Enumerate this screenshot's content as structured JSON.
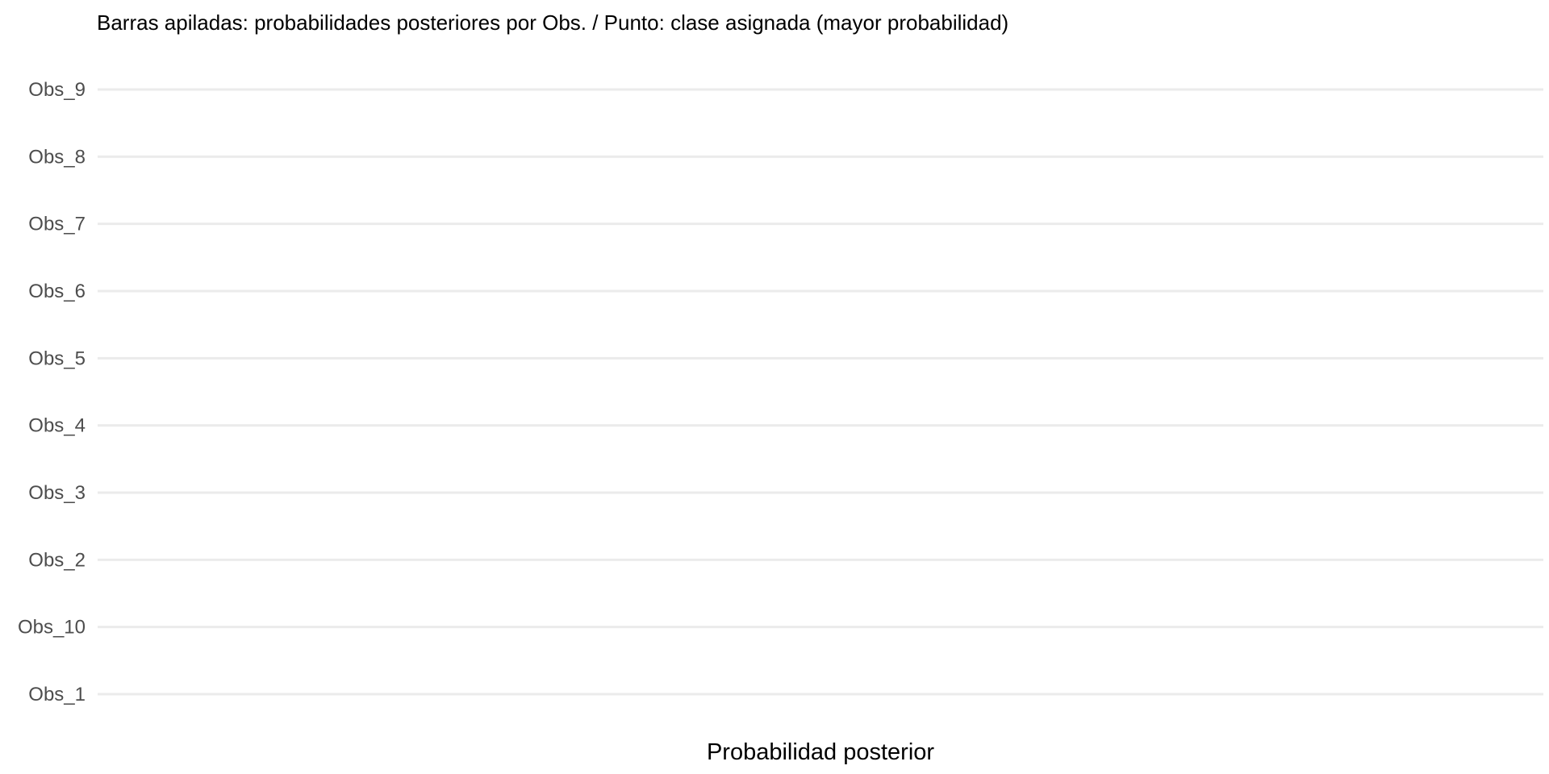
{
  "chart_data": {
    "type": "bar",
    "orientation": "horizontal",
    "stacked": true,
    "title": "Barras apiladas: probabilidades posteriores por Obs. / Punto: clase asignada (mayor probabilidad)",
    "xlabel": "Probabilidad posterior",
    "ylabel": "",
    "categories": [
      "Obs_1",
      "Obs_10",
      "Obs_2",
      "Obs_3",
      "Obs_4",
      "Obs_5",
      "Obs_6",
      "Obs_7",
      "Obs_8",
      "Obs_9"
    ],
    "series": [],
    "grid": true,
    "legend": "none",
    "colors": {
      "background": "#ffffff",
      "grid": "#ebebeb",
      "tick_text": "#4d4d4d",
      "title_text": "#000000"
    }
  }
}
